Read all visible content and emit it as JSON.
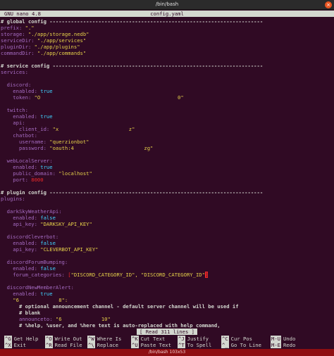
{
  "window": {
    "title": "/bin/bash",
    "close_glyph": "×"
  },
  "nano": {
    "version": "GNU nano 4.8",
    "filename": "config.yaml"
  },
  "lines": [
    [
      [
        "cm",
        "# global config ----------------------------------------------------------------------"
      ]
    ],
    [
      [
        "k",
        "prefix: "
      ],
      [
        "s",
        "\".\""
      ]
    ],
    [
      [
        "k",
        "storage: "
      ],
      [
        "s",
        "\"./app/storage.nedb\""
      ]
    ],
    [
      [
        "k",
        "serviceDir: "
      ],
      [
        "s",
        "\"./app/services\""
      ]
    ],
    [
      [
        "k",
        "pluginDir: "
      ],
      [
        "s",
        "\"./app/plugins\""
      ]
    ],
    [
      [
        "k",
        "commandDir: "
      ],
      [
        "s",
        "\"./app/commands\""
      ]
    ],
    [],
    [
      [
        "cm",
        "# service config ---------------------------------------------------------------------"
      ]
    ],
    [
      [
        "k",
        "services:"
      ]
    ],
    [],
    [
      [
        "k",
        "  discord:"
      ]
    ],
    [
      [
        "k",
        "    enabled: "
      ],
      [
        "b",
        "true"
      ]
    ],
    [
      [
        "k",
        "    token: "
      ],
      [
        "s",
        "\"O"
      ],
      [
        "smear",
        "                                             "
      ],
      [
        "s",
        "0\""
      ]
    ],
    [],
    [
      [
        "k",
        "  twitch:"
      ]
    ],
    [
      [
        "k",
        "    enabled: "
      ],
      [
        "b",
        "true"
      ]
    ],
    [
      [
        "k",
        "    api:"
      ]
    ],
    [
      [
        "k",
        "      client_id: "
      ],
      [
        "s",
        "\"x"
      ],
      [
        "smear",
        "                       "
      ],
      [
        "s",
        "z\""
      ]
    ],
    [
      [
        "k",
        "    chatbot:"
      ]
    ],
    [
      [
        "k",
        "      username: "
      ],
      [
        "s",
        "\"querzionbot\""
      ]
    ],
    [
      [
        "k",
        "      password: "
      ],
      [
        "s",
        "\"oauth:4"
      ],
      [
        "smear",
        "                       "
      ],
      [
        "s",
        "zg\""
      ]
    ],
    [],
    [
      [
        "k",
        "  webLocalServer:"
      ]
    ],
    [
      [
        "k",
        "    enabled: "
      ],
      [
        "b",
        "true"
      ]
    ],
    [
      [
        "k",
        "    public_domain: "
      ],
      [
        "s",
        "\"localhost\""
      ]
    ],
    [
      [
        "k",
        "    port: "
      ],
      [
        "n",
        "8000"
      ]
    ],
    [],
    [
      [
        "cm",
        "# plugin config ----------------------------------------------------------------------"
      ]
    ],
    [
      [
        "k",
        "plugins:"
      ]
    ],
    [],
    [
      [
        "k",
        "  darkSkyWeatherApi:"
      ]
    ],
    [
      [
        "k",
        "    enabled: "
      ],
      [
        "b",
        "false"
      ]
    ],
    [
      [
        "k",
        "    api_key: "
      ],
      [
        "s",
        "\"DARKSKY_API_KEY\""
      ]
    ],
    [],
    [
      [
        "k",
        "  discordCleverbot:"
      ]
    ],
    [
      [
        "k",
        "    enabled: "
      ],
      [
        "b",
        "false"
      ]
    ],
    [
      [
        "k",
        "    api_key: "
      ],
      [
        "s",
        "\"CLEVERBOT_API_KEY\""
      ]
    ],
    [],
    [
      [
        "k",
        "  discordForumBumping:"
      ]
    ],
    [
      [
        "k",
        "    enabled: "
      ],
      [
        "b",
        "false"
      ]
    ],
    [
      [
        "k",
        "    forum_categories: "
      ],
      [
        "n",
        "["
      ],
      [
        "s",
        "\"DISCORD_CATEGORY_ID\", \"DISCORD_CATEGORY_ID\""
      ],
      [
        "cursor",
        "]"
      ]
    ],
    [],
    [
      [
        "k",
        "  discordNewMemberAlert:"
      ]
    ],
    [
      [
        "k",
        "    enabled: "
      ],
      [
        "b",
        "true"
      ]
    ],
    [
      [
        "s",
        "    \"6"
      ],
      [
        "smear",
        "             "
      ],
      [
        "s",
        "8\":"
      ]
    ],
    [
      [
        "hint",
        "      # optional announcement channel - default server channel will be used if"
      ]
    ],
    [
      [
        "hint",
        "      # blank"
      ]
    ],
    [
      [
        "k",
        "      announceto: "
      ],
      [
        "s",
        "\"6"
      ],
      [
        "smear",
        "             "
      ],
      [
        "s",
        "10\""
      ]
    ],
    [
      [
        "hint",
        "      # %help, %user, and %here text is auto-replaced with help command,"
      ]
    ]
  ],
  "status": "[ Read 311 lines ]",
  "shortcuts": {
    "row1": [
      {
        "key": "^G",
        "label": "Get Help"
      },
      {
        "key": "^O",
        "label": "Write Out"
      },
      {
        "key": "^W",
        "label": "Where Is"
      },
      {
        "key": "^K",
        "label": "Cut Text"
      },
      {
        "key": "^J",
        "label": "Justify"
      },
      {
        "key": "^C",
        "label": "Cur Pos"
      },
      {
        "key": "M-U",
        "label": "Undo"
      }
    ],
    "row2": [
      {
        "key": "^X",
        "label": "Exit"
      },
      {
        "key": "^R",
        "label": "Read File"
      },
      {
        "key": "^\\",
        "label": "Replace"
      },
      {
        "key": "^U",
        "label": "Paste Text"
      },
      {
        "key": "^T",
        "label": "To Spell"
      },
      {
        "key": "^_",
        "label": "Go To Line"
      },
      {
        "key": "M-E",
        "label": "Redo"
      }
    ]
  },
  "taskbar": {
    "label": "/bin/bash 103x53"
  }
}
